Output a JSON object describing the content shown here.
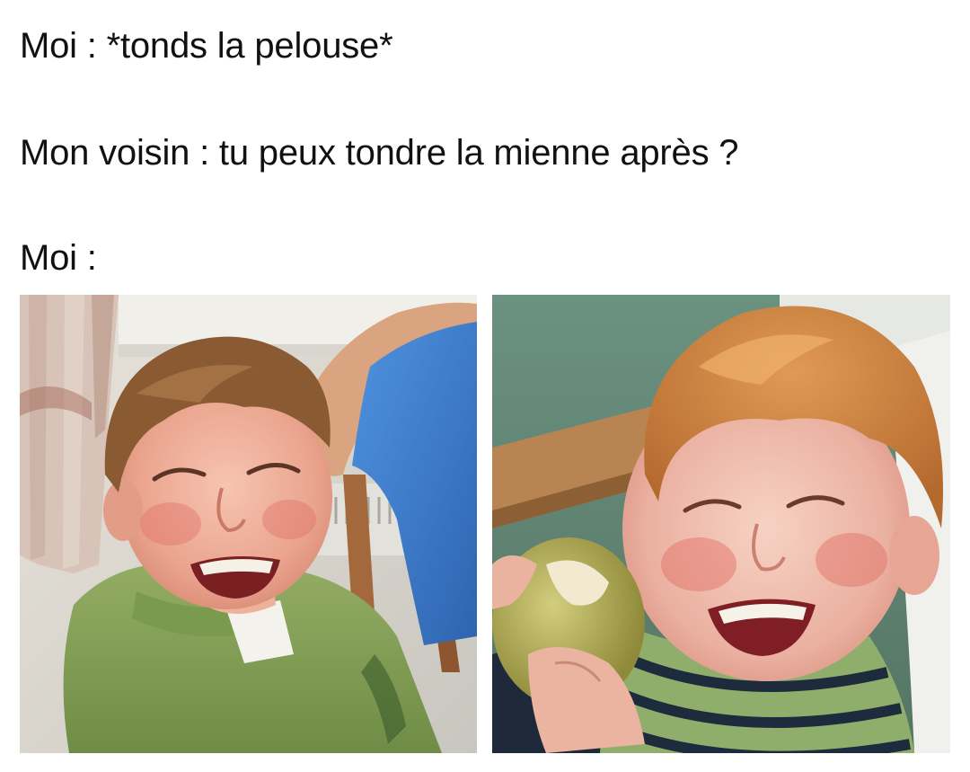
{
  "meme": {
    "lines": [
      "Moi : *tonds la pelouse*",
      "Mon voisin : tu peux tondre la mienne après ?",
      "Moi :"
    ]
  },
  "photos": [
    {
      "subject": "laughing-boy-green-polo"
    },
    {
      "subject": "laughing-redhead-boy-with-apple"
    }
  ],
  "colors": {
    "background": "#ffffff",
    "text": "#111111",
    "green_shirt": "#86a35a",
    "wall_teal": "#5f8876",
    "red_hair": "#c97a38",
    "blue_shirt": "#3d7fd0"
  }
}
